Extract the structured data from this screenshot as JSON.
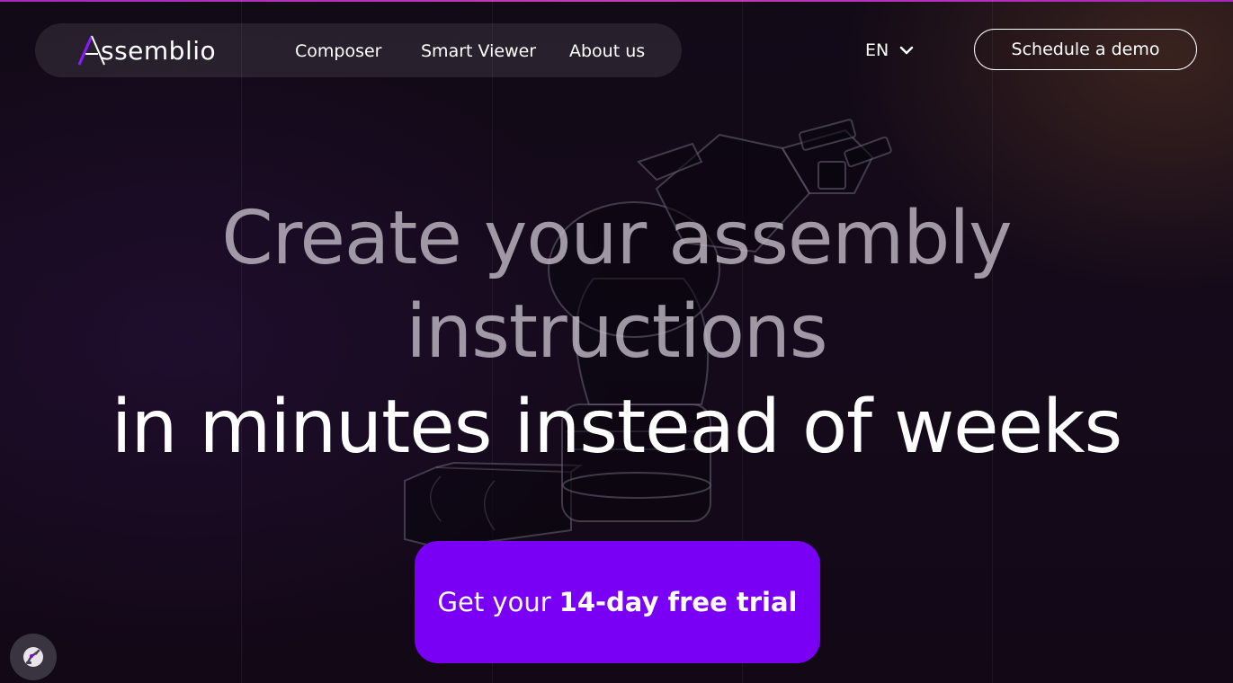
{
  "brand": {
    "logo_text": "ssemblio",
    "logo_name": "Assemblio"
  },
  "nav": {
    "links": [
      {
        "label": "Composer"
      },
      {
        "label": "Smart Viewer"
      },
      {
        "label": "About us"
      }
    ],
    "language": "EN",
    "demo_label": "Schedule a demo"
  },
  "hero": {
    "line1": "Create your assembly",
    "line2": "instructions",
    "line3": "in minutes instead of weeks"
  },
  "cta": {
    "prefix": "Get your",
    "bold": "14-day free trial"
  },
  "icons": {
    "language_chevron": "chevron-down-icon",
    "floating_button": "robot-arm-icon",
    "background": "robot-arm-illustration"
  },
  "colors": {
    "accent": "#7a00f5",
    "top_border": "#b02fb6",
    "background": "#120a17"
  }
}
